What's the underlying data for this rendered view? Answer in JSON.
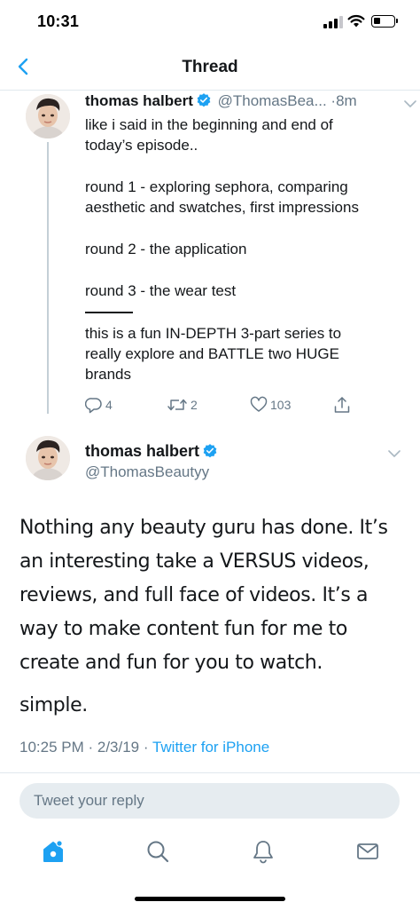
{
  "status_bar": {
    "time": "10:31"
  },
  "nav": {
    "title": "Thread"
  },
  "thread_tweet": {
    "name": "thomas halbert",
    "handle": "@ThomasBea...",
    "separator": "·",
    "time": "8m",
    "lines": [
      "like i said in the beginning and end of",
      "today’s episode..",
      "round 1 - exploring sephora, comparing",
      "aesthetic and swatches, first impressions",
      "round 2 - the application",
      "round 3 - the wear test",
      "this is a fun IN-DEPTH 3-part series to",
      "really explore and BATTLE two HUGE",
      "brands"
    ],
    "reply_count": "4",
    "retweet_count": "2",
    "like_count": "103"
  },
  "main_tweet": {
    "name": "thomas halbert",
    "handle": "@ThomasBeautyy",
    "lines": [
      "Nothing any beauty guru has done. It’s",
      "an interesting take a VERSUS videos,",
      "reviews, and full face of videos. It’s a",
      "way to make content fun for me to",
      "create and fun for you to watch.",
      "simple."
    ],
    "timestamp": "10:25 PM · 2/3/19 · ",
    "source": "Twitter for iPhone"
  },
  "reply": {
    "placeholder": "Tweet your reply"
  },
  "tabs": [
    {
      "icon": "home-icon"
    },
    {
      "icon": "search-icon"
    },
    {
      "icon": "notifications-bell-icon"
    },
    {
      "icon": "messages-envelope-icon"
    }
  ],
  "colors": {
    "accent": "#1da1f2",
    "secondary_text": "#657786",
    "primary_text": "#14171a",
    "divider": "#e1e8ed",
    "thread_line": "#c4cfd6"
  }
}
